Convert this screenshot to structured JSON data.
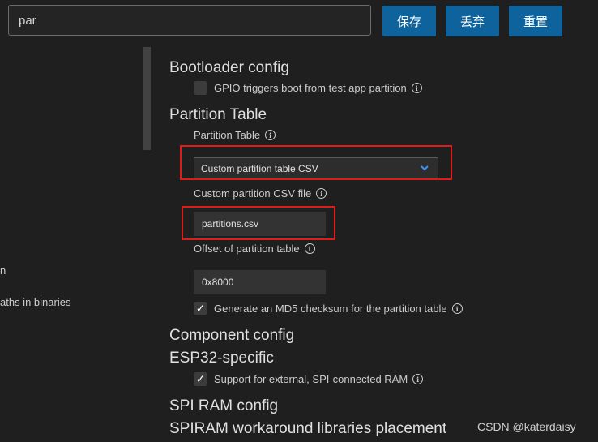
{
  "search": {
    "value": "par"
  },
  "toolbar": {
    "save_label": "保存",
    "discard_label": "丢弃",
    "reset_label": "重置"
  },
  "left_panel": {
    "items": [
      "n",
      "aths in binaries"
    ]
  },
  "sections": {
    "bootloader": {
      "title": "Bootloader config",
      "gpio_boot_label": "GPIO triggers boot from test app partition",
      "gpio_boot_checked": false
    },
    "partition_table": {
      "title": "Partition Table",
      "partition_table_label": "Partition Table",
      "partition_table_value": "Custom partition table CSV",
      "custom_csv_label": "Custom partition CSV file",
      "custom_csv_value": "partitions.csv",
      "offset_label": "Offset of partition table",
      "offset_value": "0x8000",
      "md5_label": "Generate an MD5 checksum for the partition table",
      "md5_checked": true
    },
    "component": {
      "title": "Component config"
    },
    "esp32": {
      "title": "ESP32-specific",
      "spi_ram_label": "Support for external, SPI-connected RAM",
      "spi_ram_checked": true
    },
    "spi_ram_config": {
      "title": "SPI RAM config"
    },
    "spiram_workaround": {
      "title": "SPIRAM workaround libraries placement"
    }
  },
  "icons": {
    "info": "info-icon",
    "check": "checkmark-icon",
    "chevron": "chevron-down-icon"
  },
  "colors": {
    "background": "#1f1f1f",
    "button": "#0e639c",
    "highlight": "#e01b1b",
    "dropdown_chevron": "#3794ff"
  },
  "watermark": "CSDN @katerdaisy"
}
